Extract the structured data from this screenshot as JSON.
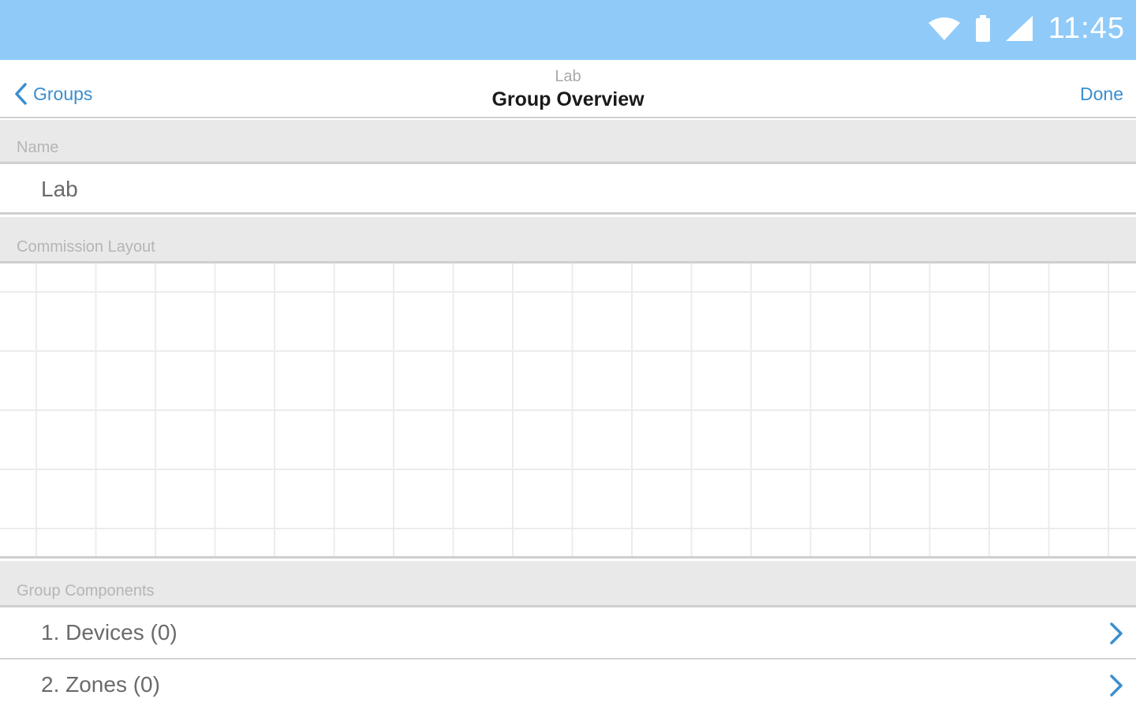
{
  "status_bar": {
    "time": "11:45",
    "icons": [
      "wifi-icon",
      "battery-icon",
      "cellular-signal-icon"
    ],
    "color": "#90caf9"
  },
  "nav": {
    "back_label": "Groups",
    "subtitle": "Lab",
    "title": "Group Overview",
    "done_label": "Done",
    "accent": "#3a8ecf"
  },
  "sections": {
    "name_header": "Name",
    "name_value": "Lab",
    "layout_header": "Commission Layout",
    "components_header": "Group Components"
  },
  "components": [
    {
      "label": "1. Devices (0)"
    },
    {
      "label": "2. Zones (0)"
    }
  ]
}
